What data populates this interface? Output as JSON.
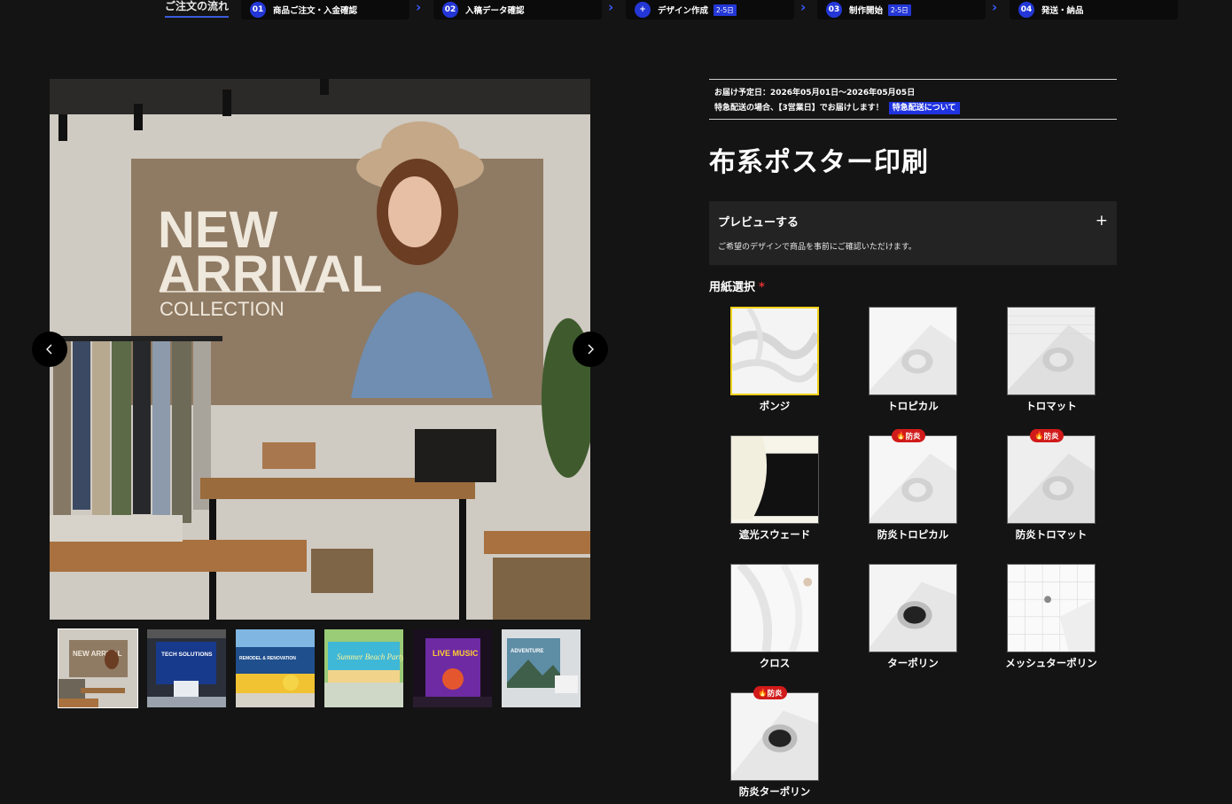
{
  "flow": {
    "title": "ご注文の流れ",
    "steps": [
      {
        "num": "01",
        "label": "商品ご注文・入金確認",
        "badge": ""
      },
      {
        "num": "02",
        "label": "入稿データ確認",
        "badge": ""
      },
      {
        "num": "+",
        "label": "デザイン作成",
        "badge": "2-5日"
      },
      {
        "num": "03",
        "label": "制作開始",
        "badge": "2-5日"
      },
      {
        "num": "04",
        "label": "発送・納品",
        "badge": ""
      }
    ]
  },
  "gallery": {
    "main_image": {
      "banner_line1": "NEW",
      "banner_line2": "ARRIVAL",
      "banner_line3": "COLLECTION"
    },
    "thumbnails": [
      {
        "caption": "NEW ARRIVAL",
        "active": true
      },
      {
        "caption": "TECH SOLUTIONS",
        "active": false
      },
      {
        "caption": "REMODEL & RENOVATION",
        "active": false
      },
      {
        "caption": "Summer Beach Party",
        "active": false
      },
      {
        "caption": "LIVE MUSIC",
        "active": false
      },
      {
        "caption": "ADVENTURE",
        "active": false
      }
    ]
  },
  "delivery": {
    "line1": "お届け予定日：2026年05月01日〜2026年05月05日",
    "line2": "特急配送の場合、【3営業日】でお届けします！",
    "link": "特急配送について"
  },
  "product": {
    "title": "布系ポスター印刷"
  },
  "preview": {
    "title": "プレビューする",
    "toggle": "+",
    "description": "ご希望のデザインで商品を事前にご確認いただけます。"
  },
  "paper": {
    "label": "用紙選択",
    "required_mark": "*",
    "fire_badge_label": "防炎",
    "options": [
      {
        "name": "ポンジ",
        "selected": true,
        "fireproof": false,
        "icon": "fabric-drape"
      },
      {
        "name": "トロピカル",
        "selected": false,
        "fireproof": false,
        "icon": "fabric-roll"
      },
      {
        "name": "トロマット",
        "selected": false,
        "fireproof": false,
        "icon": "fabric-roll-textured"
      },
      {
        "name": "遮光スウェード",
        "selected": false,
        "fireproof": false,
        "icon": "blackout-sheet"
      },
      {
        "name": "防炎トロピカル",
        "selected": false,
        "fireproof": true,
        "icon": "fabric-roll"
      },
      {
        "name": "防炎トロマット",
        "selected": false,
        "fireproof": true,
        "icon": "fabric-roll-textured"
      },
      {
        "name": "クロス",
        "selected": false,
        "fireproof": false,
        "icon": "cloth-sheet"
      },
      {
        "name": "ターポリン",
        "selected": false,
        "fireproof": false,
        "icon": "tarpaulin-roll"
      },
      {
        "name": "メッシュターポリン",
        "selected": false,
        "fireproof": false,
        "icon": "mesh-sheet"
      },
      {
        "name": "防炎ターポリン",
        "selected": false,
        "fireproof": true,
        "icon": "tarpaulin-roll"
      }
    ]
  },
  "colors": {
    "background": "#141414",
    "accent_blue": "#2437d6",
    "selected_border": "#f2d21b",
    "fire_badge": "#d11a1a"
  }
}
